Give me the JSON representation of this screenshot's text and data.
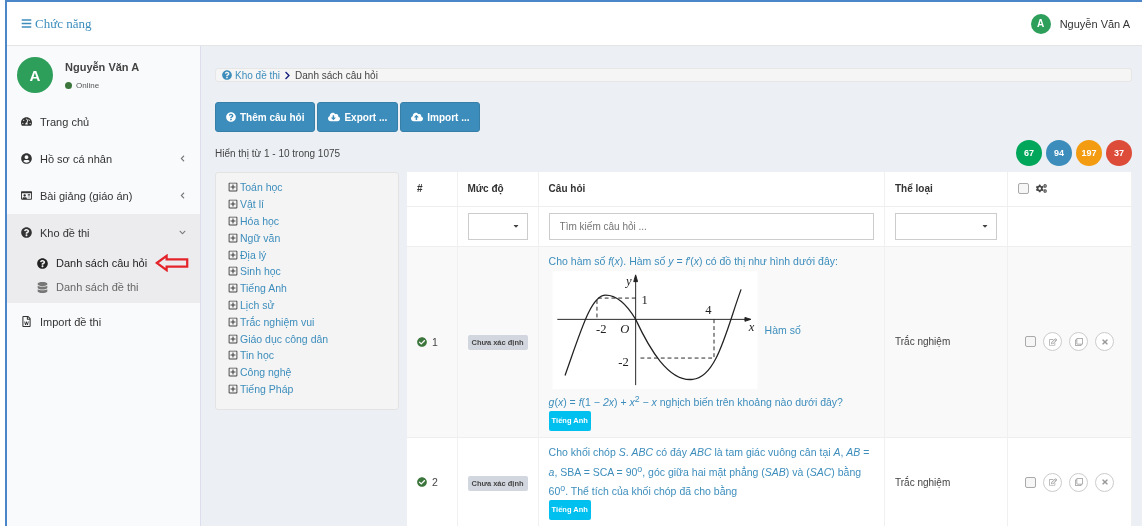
{
  "topbar": {
    "menu_label": "Chức năng",
    "user_initial": "A",
    "user_name": "Nguyễn Văn A"
  },
  "sidebar": {
    "user": {
      "initial": "A",
      "name": "Nguyễn Văn A",
      "status": "Online"
    },
    "items": [
      {
        "kind": "dashboard",
        "label": "Trang chủ",
        "selected": false
      },
      {
        "kind": "user",
        "label": "Hồ sơ cá nhân",
        "expanded": false,
        "selected": false,
        "has_caret": true
      },
      {
        "kind": "card",
        "label": "Bài giảng (giáo án)",
        "expanded": false,
        "selected": false,
        "has_caret": true
      },
      {
        "kind": "question",
        "label": "Kho đề thi",
        "expanded": true,
        "selected": true,
        "has_caret": true,
        "children": [
          {
            "kind": "question",
            "label": "Danh sách câu hỏi",
            "selected": true
          },
          {
            "kind": "database",
            "label": "Danh sách đề thi",
            "selected": false
          }
        ]
      },
      {
        "kind": "word",
        "label": "Import đề thi",
        "selected": false
      }
    ]
  },
  "breadcrumb": [
    "Kho đề thi",
    "Danh sách câu hỏi"
  ],
  "buttons": [
    {
      "kind": "question",
      "label": "Thêm câu hỏi"
    },
    {
      "kind": "download",
      "label": "Export ..."
    },
    {
      "kind": "upload",
      "label": "Import ..."
    }
  ],
  "summary": "Hiển thị từ 1 - 10 trong 1075",
  "counters": [
    {
      "value": "67",
      "color": "#00a65a"
    },
    {
      "value": "94",
      "color": "#3c8dbc"
    },
    {
      "value": "197",
      "color": "#f39c12"
    },
    {
      "value": "37",
      "color": "#dd4b39"
    }
  ],
  "subjects": [
    "Toán học",
    "Vật lí",
    "Hóa học",
    "Ngữ văn",
    "Địa lý",
    "Sinh học",
    "Tiếng Anh",
    "Lịch sử",
    "Trắc nghiệm vui",
    "Giáo dục công dân",
    "Tin học",
    "Công nghệ",
    "Tiếng Pháp"
  ],
  "table": {
    "columns": [
      "#",
      "Mức độ",
      "Câu hỏi",
      "Thể loại"
    ],
    "all_checked": false,
    "search_placeholder": "Tìm kiếm câu hỏi ...",
    "rows": [
      {
        "number": "1",
        "verified": true,
        "level": "Chưa xác định",
        "question_before": "Cho hàm số *f*(*x*). Hàm số *y* = *f*′(*x*) có đồ thị như hình dưới đây:",
        "figure": {
          "labels": [
            "y",
            "1",
            "-2",
            "O",
            "4",
            "x",
            "-2"
          ]
        },
        "question_inline": "Hàm số",
        "question_after": "*g*(*x*) = *f*(1 − *2x*) + *x*$^{2}$ − *x* nghịch biến trên khoảng nào dưới đây?",
        "tag": "Tiếng Anh",
        "type": "Trắc nghiệm",
        "checked": false
      },
      {
        "number": "2",
        "verified": true,
        "level": "Chưa xác định",
        "question_before": "Cho khối chóp *S*. *ABC* có đáy *ABC* là tam giác vuông cân tại *A*, *AB* = *a*, SBA = SCA = 90$^{o}$, góc giữa hai mặt phẳng (*SAB*) và (*SAC*) bằng 60$^{o}$. Thể tích của khối chóp đã cho bằng",
        "tag": "Tiếng Anh",
        "type": "Trắc nghiệm",
        "checked": false
      }
    ]
  }
}
